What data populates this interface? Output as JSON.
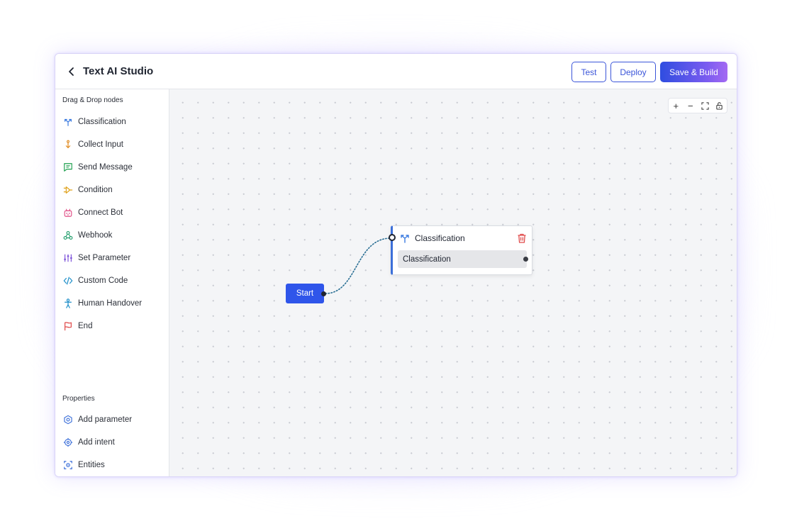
{
  "header": {
    "title": "Text AI Studio",
    "test_label": "Test",
    "deploy_label": "Deploy",
    "save_label": "Save & Build"
  },
  "sidebar": {
    "nodes_title": "Drag & Drop nodes",
    "nodes": [
      {
        "label": "Classification",
        "icon": "classification-icon",
        "color": "#3b7be0"
      },
      {
        "label": "Collect Input",
        "icon": "collect-input-icon",
        "color": "#e08a1f"
      },
      {
        "label": "Send Message",
        "icon": "send-message-icon",
        "color": "#1fa04f"
      },
      {
        "label": "Condition",
        "icon": "condition-icon",
        "color": "#e0a31f"
      },
      {
        "label": "Connect Bot",
        "icon": "connect-bot-icon",
        "color": "#e04d86"
      },
      {
        "label": "Webhook",
        "icon": "webhook-icon",
        "color": "#1f9c6a"
      },
      {
        "label": "Set Parameter",
        "icon": "set-parameter-icon",
        "color": "#7a4fd8"
      },
      {
        "label": "Custom Code",
        "icon": "custom-code-icon",
        "color": "#1f8fc9"
      },
      {
        "label": "Human Handover",
        "icon": "human-handover-icon",
        "color": "#1f8fc9"
      },
      {
        "label": "End",
        "icon": "end-flag-icon",
        "color": "#e04b4b"
      }
    ],
    "properties_title": "Properties",
    "properties": [
      {
        "label": "Add parameter",
        "icon": "add-parameter-icon",
        "color": "#3b6fd9"
      },
      {
        "label": "Add intent",
        "icon": "add-intent-icon",
        "color": "#3b6fd9"
      },
      {
        "label": "Entities",
        "icon": "entities-icon",
        "color": "#3b6fd9"
      }
    ]
  },
  "canvas": {
    "zoom_controls": [
      "+",
      "−"
    ],
    "start_node": {
      "label": "Start"
    },
    "classification_node": {
      "title": "Classification",
      "item": "Classification"
    }
  },
  "colors": {
    "accent": "#2f55ea",
    "gradient_start": "#2f4de0",
    "gradient_end": "#a46af2"
  }
}
